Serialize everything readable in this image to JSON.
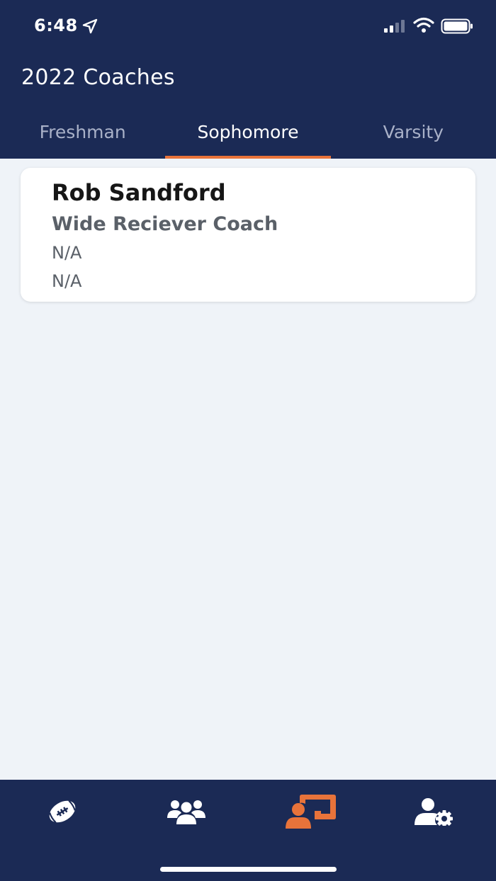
{
  "status_bar": {
    "time": "6:48"
  },
  "header": {
    "title": "2022 Coaches"
  },
  "tabs": [
    {
      "label": "Freshman",
      "active": false
    },
    {
      "label": "Sophomore",
      "active": true
    },
    {
      "label": "Varsity",
      "active": false
    }
  ],
  "coaches": [
    {
      "name": "Rob Sandford",
      "role": "Wide Reciever Coach",
      "line1": "N/A",
      "line2": "N/A"
    }
  ],
  "bottom_nav": [
    {
      "icon": "football-icon",
      "active": false
    },
    {
      "icon": "team-icon",
      "active": false
    },
    {
      "icon": "coach-presentation-icon",
      "active": true
    },
    {
      "icon": "user-settings-icon",
      "active": false
    }
  ],
  "colors": {
    "navy": "#1b2a55",
    "accent": "#e8733a",
    "background": "#eff3f8"
  }
}
